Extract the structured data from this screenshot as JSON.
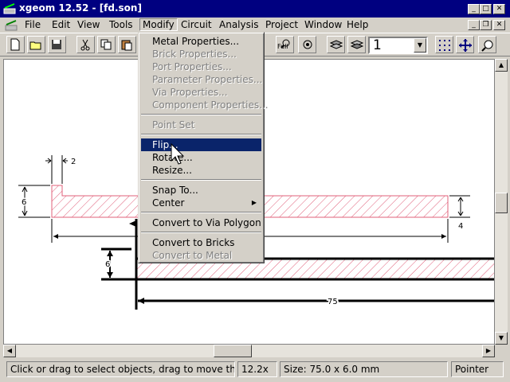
{
  "window": {
    "title": "xgeom 12.52 - [fd.son]"
  },
  "menubar": {
    "items": [
      "File",
      "Edit",
      "View",
      "Tools",
      "Modify",
      "Circuit",
      "Analysis",
      "Project",
      "Window",
      "Help"
    ]
  },
  "toolbar": {
    "zoom_combo_value": "1",
    "full_button_label": "Full"
  },
  "modify_menu": {
    "items": [
      {
        "label": "Metal Properties...",
        "enabled": true
      },
      {
        "label": "Brick Properties...",
        "enabled": false
      },
      {
        "label": "Port Properties...",
        "enabled": false
      },
      {
        "label": "Parameter Properties...",
        "enabled": false
      },
      {
        "label": "Via Properties...",
        "enabled": false
      },
      {
        "label": "Component Properties...",
        "enabled": false
      },
      {
        "label": "Point Set",
        "enabled": false
      },
      {
        "label": "Flip...",
        "enabled": true,
        "selected": true
      },
      {
        "label": "Rotate...",
        "enabled": true
      },
      {
        "label": "Resize...",
        "enabled": true
      },
      {
        "label": "Snap To...",
        "enabled": true
      },
      {
        "label": "Center",
        "enabled": true,
        "submenu": true
      },
      {
        "label": "Convert to Via Polygon",
        "enabled": true
      },
      {
        "label": "Convert to Bricks",
        "enabled": true
      },
      {
        "label": "Convert to Metal",
        "enabled": false
      }
    ]
  },
  "canvas": {
    "dimensions": {
      "gap": "2",
      "left_height": "6",
      "right_height": "4",
      "lower_height": "6",
      "lower_width": "75"
    }
  },
  "statusbar": {
    "hint": "Click or drag to select objects, drag to move them",
    "zoom": "12.2x",
    "size": "Size: 75.0 x 6.0 mm",
    "mode": "Pointer"
  },
  "colors": {
    "titlebar": "#000080",
    "menu_highlight": "#0a246a",
    "hatch": "#e0607a"
  }
}
